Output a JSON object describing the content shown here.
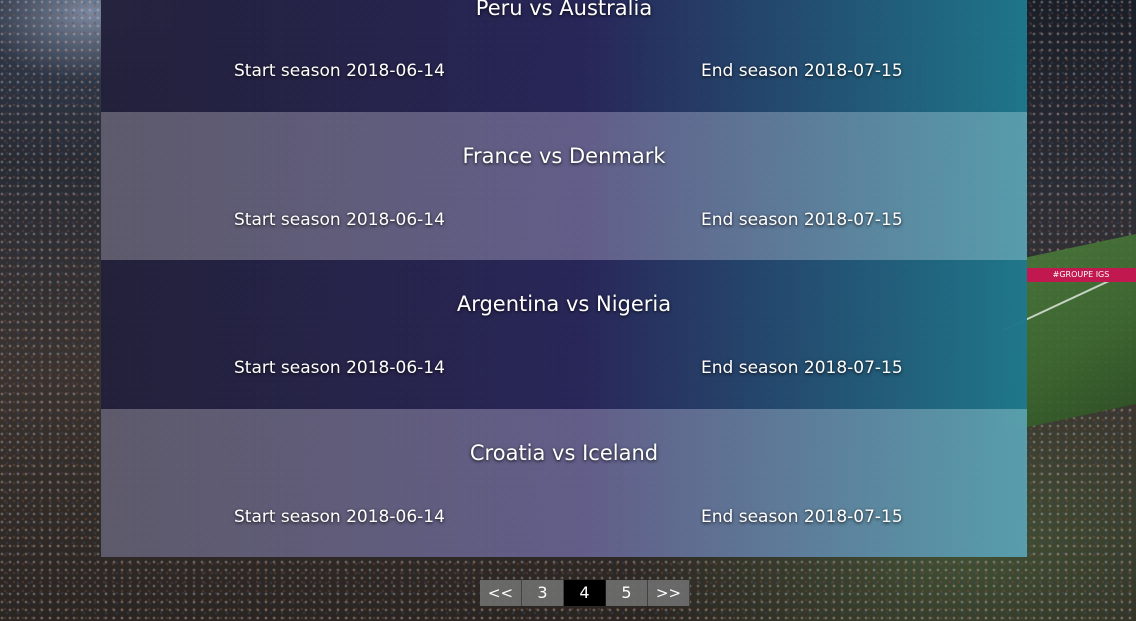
{
  "matches": [
    {
      "title": "Peru vs Australia",
      "start": "Start season 2018-06-14",
      "end": "End season 2018-07-15"
    },
    {
      "title": "France vs Denmark",
      "start": "Start season 2018-06-14",
      "end": "End season 2018-07-15"
    },
    {
      "title": "Argentina vs Nigeria",
      "start": "Start season 2018-06-14",
      "end": "End season 2018-07-15"
    },
    {
      "title": "Croatia vs Iceland",
      "start": "Start season 2018-06-14",
      "end": "End season 2018-07-15"
    }
  ],
  "pagination": {
    "prev": "<<",
    "pages": [
      "3",
      "4",
      "5"
    ],
    "current": "4",
    "next": ">>"
  },
  "background": {
    "ad_text": "#GROUPE IGS"
  },
  "colors": {
    "active_page": "#000000",
    "page_button": "#6e6e6e",
    "text": "#ffffff"
  }
}
